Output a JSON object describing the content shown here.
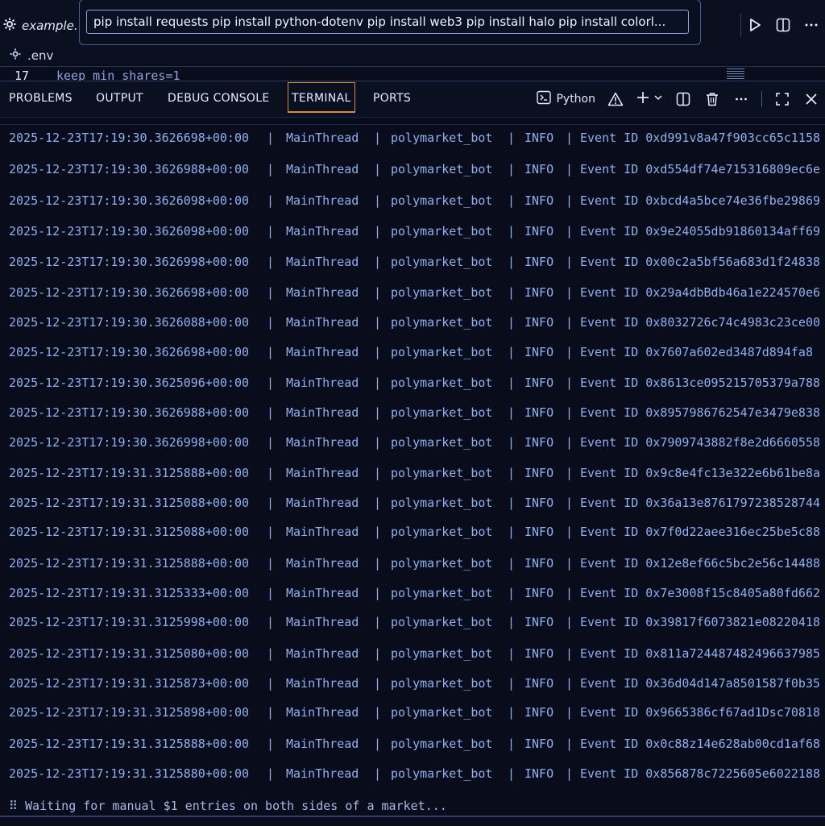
{
  "editor_tab": {
    "label": "example.",
    "icon": "gear-icon"
  },
  "command_input": "pip install requests pip install python-dotenv pip install web3 pip install halo pip install colorl...",
  "breadcrumb": {
    "icon": "gear-icon",
    "file": ".env"
  },
  "code": {
    "line_number": "17",
    "text": "keep_min_shares=1"
  },
  "panel": {
    "tabs": [
      "PROBLEMS",
      "OUTPUT",
      "DEBUG CONSOLE",
      "TERMINAL",
      "PORTS"
    ],
    "active_tab": "TERMINAL",
    "shell_label": "Python",
    "colors": {
      "active_tab_border": "#d88a3f",
      "log_text": "#8fb0f0",
      "background": "#090d1b"
    }
  },
  "terminal": {
    "rows": [
      {
        "ts": "2025-12-23T17:19:30.3626698+00:00",
        "thread": "MainThread",
        "module": "polymarket_bot",
        "level": "INFO",
        "event": "Event ID 0xd991v8a47f903cc65c1158"
      },
      {
        "ts": "2025-12-23T17:19:30.3626988+00:00",
        "thread": "MainThread",
        "module": "polymarket_bot",
        "level": "INFO",
        "event": "Event ID 0xd554df74e715316809ec6e"
      },
      {
        "ts": "2025-12-23T17:19:30.3626098+00:00",
        "thread": "MainThread",
        "module": "polymarket_bot",
        "level": "INFO",
        "event": "Event ID 0xbcd4a5bce74e36fbe29869"
      },
      {
        "ts": "2025-12-23T17:19:30.3626098+00:00",
        "thread": "MainThread",
        "module": "polymarket_bot",
        "level": "INFO",
        "event": "Event ID 0x9e24055db91860134aff69"
      },
      {
        "ts": "2025-12-23T17:19:30.3626998+00:00",
        "thread": "MainThread",
        "module": "polymarket_bot",
        "level": "INFO",
        "event": "Event ID 0x00c2a5bf56a683d1f24838"
      },
      {
        "ts": "2025-12-23T17:19:30.3626698+00:00",
        "thread": "MainThread",
        "module": "polymarket_bot",
        "level": "INFO",
        "event": "Event ID 0x29a4dbBdb46a1e224570e6"
      },
      {
        "ts": "2025-12-23T17:19:30.3626088+00:00",
        "thread": "MainThread",
        "module": "polymarket_bot",
        "level": "INFO",
        "event": "Event ID 0x8032726c74c4983c23ce00"
      },
      {
        "ts": "2025-12-23T17:19:30.3626698+00:00",
        "thread": "MainThread",
        "module": "polymarket_bot",
        "level": "INFO",
        "event": "Event ID 0x7607a602ed3487d894fa8"
      },
      {
        "ts": "2025-12-23T17:19:30.3625096+00:00",
        "thread": "MainThread",
        "module": "polymarket_bot",
        "level": "INFO",
        "event": "Event ID 0x8613ce095215705379a788"
      },
      {
        "ts": "2025-12-23T17:19:30.3626988+00:00",
        "thread": "MainThread",
        "module": "polymarket_bot",
        "level": "INFO",
        "event": "Event ID 0x8957986762547e3479e838"
      },
      {
        "ts": "2025-12-23T17:19:30.3626998+00:00",
        "thread": "MainThread",
        "module": "polymarket_bot",
        "level": "INFO",
        "event": "Event ID 0x7909743882f8e2d6660558"
      },
      {
        "ts": "2025-12-23T17:19:31.3125888+00:00",
        "thread": "MainThread",
        "module": "polymarket_bot",
        "level": "INFO",
        "event": "Event ID 0x9c8e4fc13e322e6b61be8a"
      },
      {
        "ts": "2025-12-23T17:19:31.3125088+00:00",
        "thread": "MainThread",
        "module": "polymarket_bot",
        "level": "INFO",
        "event": "Event ID 0x36a13e8761797238528744"
      },
      {
        "ts": "2025-12-23T17:19:31.3125088+00:00",
        "thread": "MainThread",
        "module": "polymarket_bot",
        "level": "INFO",
        "event": "Event ID 0x7f0d22aee316ec25be5c88"
      },
      {
        "ts": "2025-12-23T17:19:31.3125888+00:00",
        "thread": "MainThread",
        "module": "polymarket_bot",
        "level": "INFO",
        "event": "Event ID 0x12e8ef66c5bc2e56c14488"
      },
      {
        "ts": "2025-12-23T17:19:31.3125333+00:00",
        "thread": "MainThread",
        "module": "polymarket_bot",
        "level": "INFO",
        "event": "Event ID 0x7e3008f15c8405a80fd662"
      },
      {
        "ts": "2025-12-23T17:19:31.3125998+00:00",
        "thread": "MainThread",
        "module": "polymarket_bot",
        "level": "INFO",
        "event": "Event ID 0x39817f6073821e08220418"
      },
      {
        "ts": "2025-12-23T17:19:31.3125080+00:00",
        "thread": "MainThread",
        "module": "polymarket_bot",
        "level": "INFO",
        "event": "Event ID 0x811a724487482496637985"
      },
      {
        "ts": "2025-12-23T17:19:31.3125873+00:00",
        "thread": "MainThread",
        "module": "polymarket_bot",
        "level": "INFO",
        "event": "Event ID 0x36d04d147a8501587f0b35"
      },
      {
        "ts": "2025-12-23T17:19:31.3125898+00:00",
        "thread": "MainThread",
        "module": "polymarket_bot",
        "level": "INFO",
        "event": "Event ID 0x9665386cf67ad1Dsc70818"
      },
      {
        "ts": "2025-12-23T17:19:31.3125888+00:00",
        "thread": "MainThread",
        "module": "polymarket_bot",
        "level": "INFO",
        "event": "Event ID 0x0c88z14e628ab00cd1af68"
      },
      {
        "ts": "2025-12-23T17:19:31.3125880+00:00",
        "thread": "MainThread",
        "module": "polymarket_bot",
        "level": "INFO",
        "event": "Event ID 0x856878c7225605e6022188"
      }
    ],
    "status": "⠿ Waiting for manual $1 entries on both sides of a market..."
  }
}
